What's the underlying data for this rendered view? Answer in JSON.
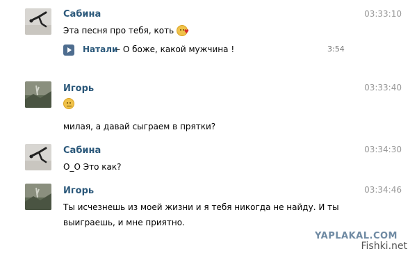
{
  "messages": [
    {
      "name": "Сабина",
      "time": "03:33:10",
      "avatar_icon": "dancer-avatar-icon",
      "text": "Эта песня про тебя, коть",
      "audio": {
        "artist": "Натали",
        "separator": " – ",
        "title": "О боже, какой мужчина !",
        "duration": "3:54"
      }
    },
    {
      "name": "Игорь",
      "time": "03:33:40",
      "avatar_icon": "landscape-avatar-icon",
      "text": "милая, а давай сыграем в прятки?"
    },
    {
      "name": "Сабина",
      "time": "03:34:30",
      "avatar_icon": "dancer-avatar-icon",
      "text": "О_О Это как?"
    },
    {
      "name": "Игорь",
      "time": "03:34:46",
      "avatar_icon": "landscape-avatar-icon",
      "text_line1": "Ты исчезнешь из моей жизни и я тебя никогда не найду. И ты",
      "text_line2": "выиграешь, и мне приятно."
    }
  ],
  "watermark": {
    "site1": "YAPLAKAL.COM",
    "site2": "Fishki.net"
  }
}
